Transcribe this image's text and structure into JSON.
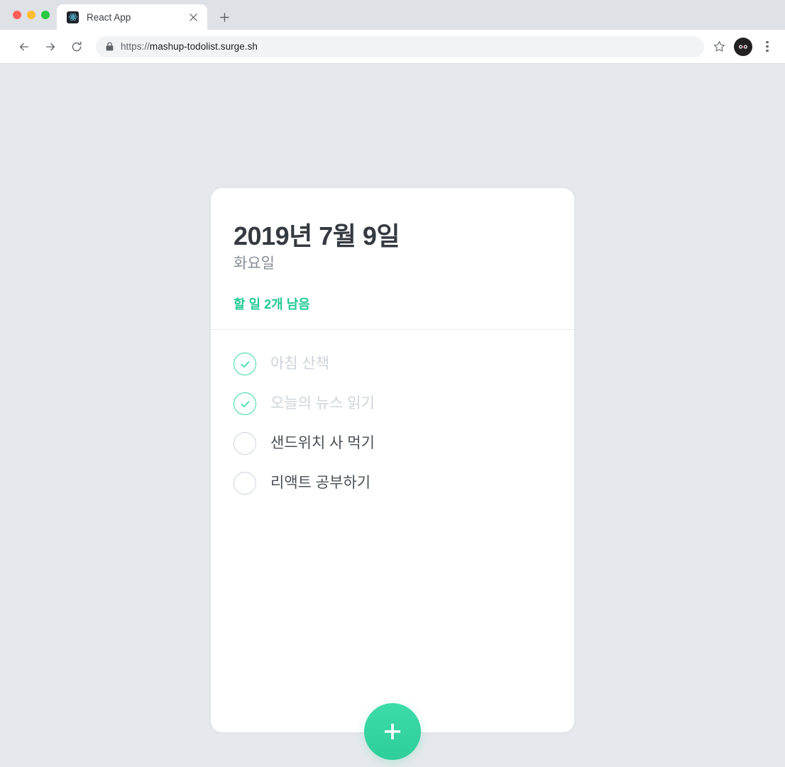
{
  "browser": {
    "traffic_lights": {
      "close_label": "close-window",
      "minimize_label": "minimize-window",
      "maximize_label": "maximize-window",
      "close_color": "#ff5f57",
      "minimize_color": "#febc2e",
      "maximize_color": "#28c840"
    },
    "tab": {
      "title": "React App",
      "favicon_name": "react-favicon",
      "close_label": "×"
    },
    "new_tab_label": "+",
    "nav": {
      "back_label": "←",
      "forward_label": "→",
      "reload_label": "⟳"
    },
    "omnibox": {
      "lock_icon": "lock-icon",
      "scheme": "https://",
      "host": "mashup-todolist.surge.sh",
      "full_url": "https://mashup-todolist.surge.sh"
    },
    "star_label": "☆",
    "avatar_label": "profile-avatar",
    "menu_label": "⋮"
  },
  "app": {
    "date": "2019년 7월 9일",
    "day_of_week": "화요일",
    "tasks_left_text": "할 일 2개 남음",
    "tasks_left_count": 2,
    "accent_color": "#20c997",
    "fab_color": "#38d9a9",
    "add_button_label": "+",
    "todos": [
      {
        "text": "아침 산책",
        "done": true
      },
      {
        "text": "오늘의 뉴스 읽기",
        "done": true
      },
      {
        "text": "샌드위치 사 먹기",
        "done": false
      },
      {
        "text": "리액트 공부하기",
        "done": false
      }
    ]
  }
}
